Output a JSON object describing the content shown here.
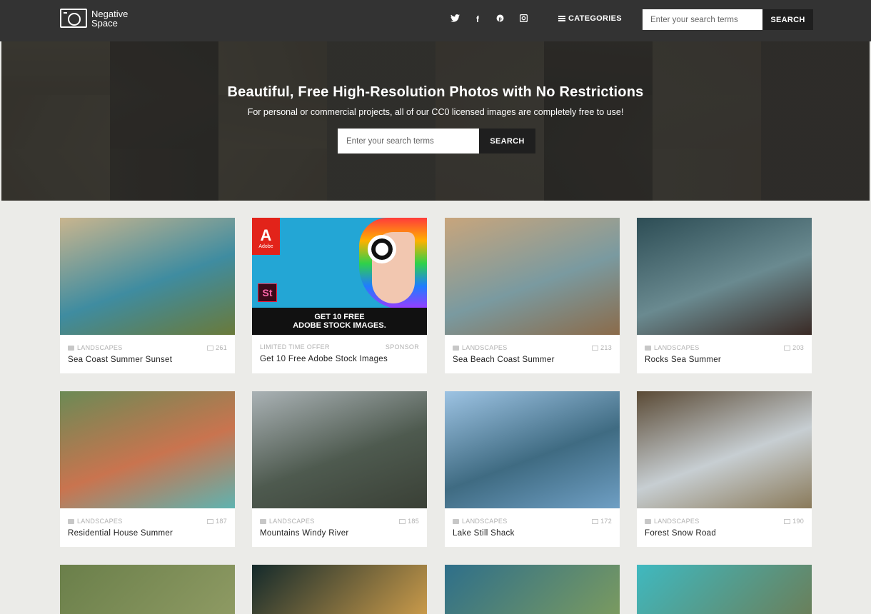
{
  "header": {
    "logo_line1": "Negative",
    "logo_line2": "Space",
    "social": [
      {
        "icon": "twitter-icon",
        "glyph": "🐦"
      },
      {
        "icon": "facebook-icon",
        "glyph": "f"
      },
      {
        "icon": "pinterest-icon",
        "glyph": "℗"
      },
      {
        "icon": "instagram-icon",
        "glyph": "◙"
      }
    ],
    "categories_label": "CATEGORIES",
    "search_placeholder": "Enter your search terms",
    "search_button": "SEARCH"
  },
  "hero": {
    "title": "Beautiful, Free High-Resolution Photos with No Restrictions",
    "subtitle": "For personal or commercial projects, all of our CC0 licensed images are completely free to use!",
    "search_placeholder": "Enter your search terms",
    "search_button": "SEARCH"
  },
  "cards": [
    {
      "category": "LANDSCAPES",
      "count": "261",
      "title": "Sea Coast Summer Sunset",
      "colors": [
        "#c9b58e",
        "#3f8ca0",
        "#6a7a3a"
      ]
    },
    {
      "category": "LIMITED TIME OFFER",
      "count": "SPONSOR",
      "title": "Get 10 Free Adobe Stock Images",
      "ad": true,
      "ad_line1": "GET 10 FREE",
      "ad_line2": "ADOBE STOCK IMAGES.",
      "adobe_label": "Adobe",
      "stock_label": "St"
    },
    {
      "category": "LANDSCAPES",
      "count": "213",
      "title": "Sea Beach Coast Summer",
      "colors": [
        "#c8a57c",
        "#7a9aa0",
        "#8b6b4a"
      ]
    },
    {
      "category": "LANDSCAPES",
      "count": "203",
      "title": "Rocks Sea Summer",
      "colors": [
        "#2d4d55",
        "#6a8a90",
        "#3a2a25"
      ]
    },
    {
      "category": "LANDSCAPES",
      "count": "187",
      "title": "Residential House Summer",
      "colors": [
        "#6b8a55",
        "#c9744f",
        "#5fb3b0"
      ]
    },
    {
      "category": "LANDSCAPES",
      "count": "185",
      "title": "Mountains Windy River",
      "colors": [
        "#aab2b5",
        "#4e5a4f",
        "#3a4036"
      ]
    },
    {
      "category": "LANDSCAPES",
      "count": "172",
      "title": "Lake Still Shack",
      "colors": [
        "#9dc3e3",
        "#3f6b82",
        "#6f9fc4"
      ]
    },
    {
      "category": "LANDSCAPES",
      "count": "190",
      "title": "Forest Snow Road",
      "colors": [
        "#5a4a35",
        "#c7ced2",
        "#8a7a5a"
      ]
    }
  ],
  "partial_cards": [
    {
      "colors": [
        "#6a7f4a",
        "#8e9a63"
      ]
    },
    {
      "colors": [
        "#142a2b",
        "#c99a4a"
      ]
    },
    {
      "colors": [
        "#2e6f8a",
        "#7a9a60"
      ]
    },
    {
      "colors": [
        "#3fb9c0",
        "#6a7f5a"
      ]
    }
  ]
}
